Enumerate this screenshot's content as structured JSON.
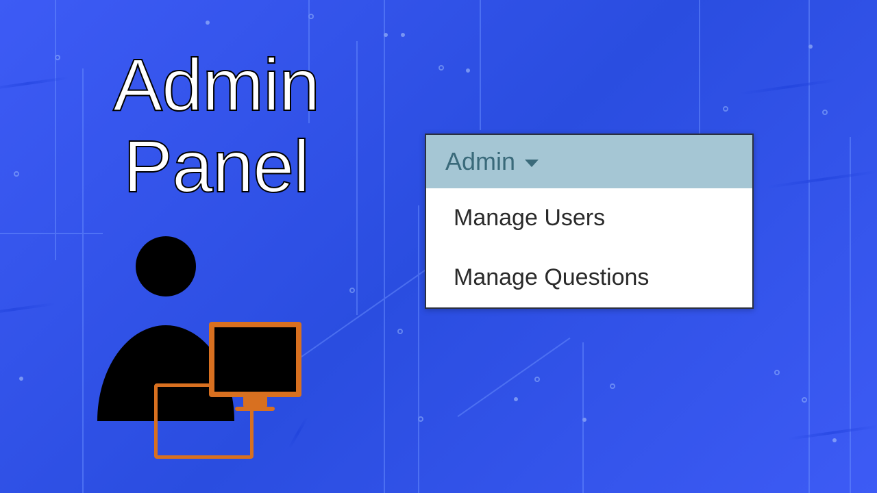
{
  "title": {
    "line1": "Admin",
    "line2": "Panel"
  },
  "dropdown": {
    "label": "Admin",
    "items": [
      {
        "label": "Manage Users"
      },
      {
        "label": "Manage Questions"
      }
    ]
  }
}
